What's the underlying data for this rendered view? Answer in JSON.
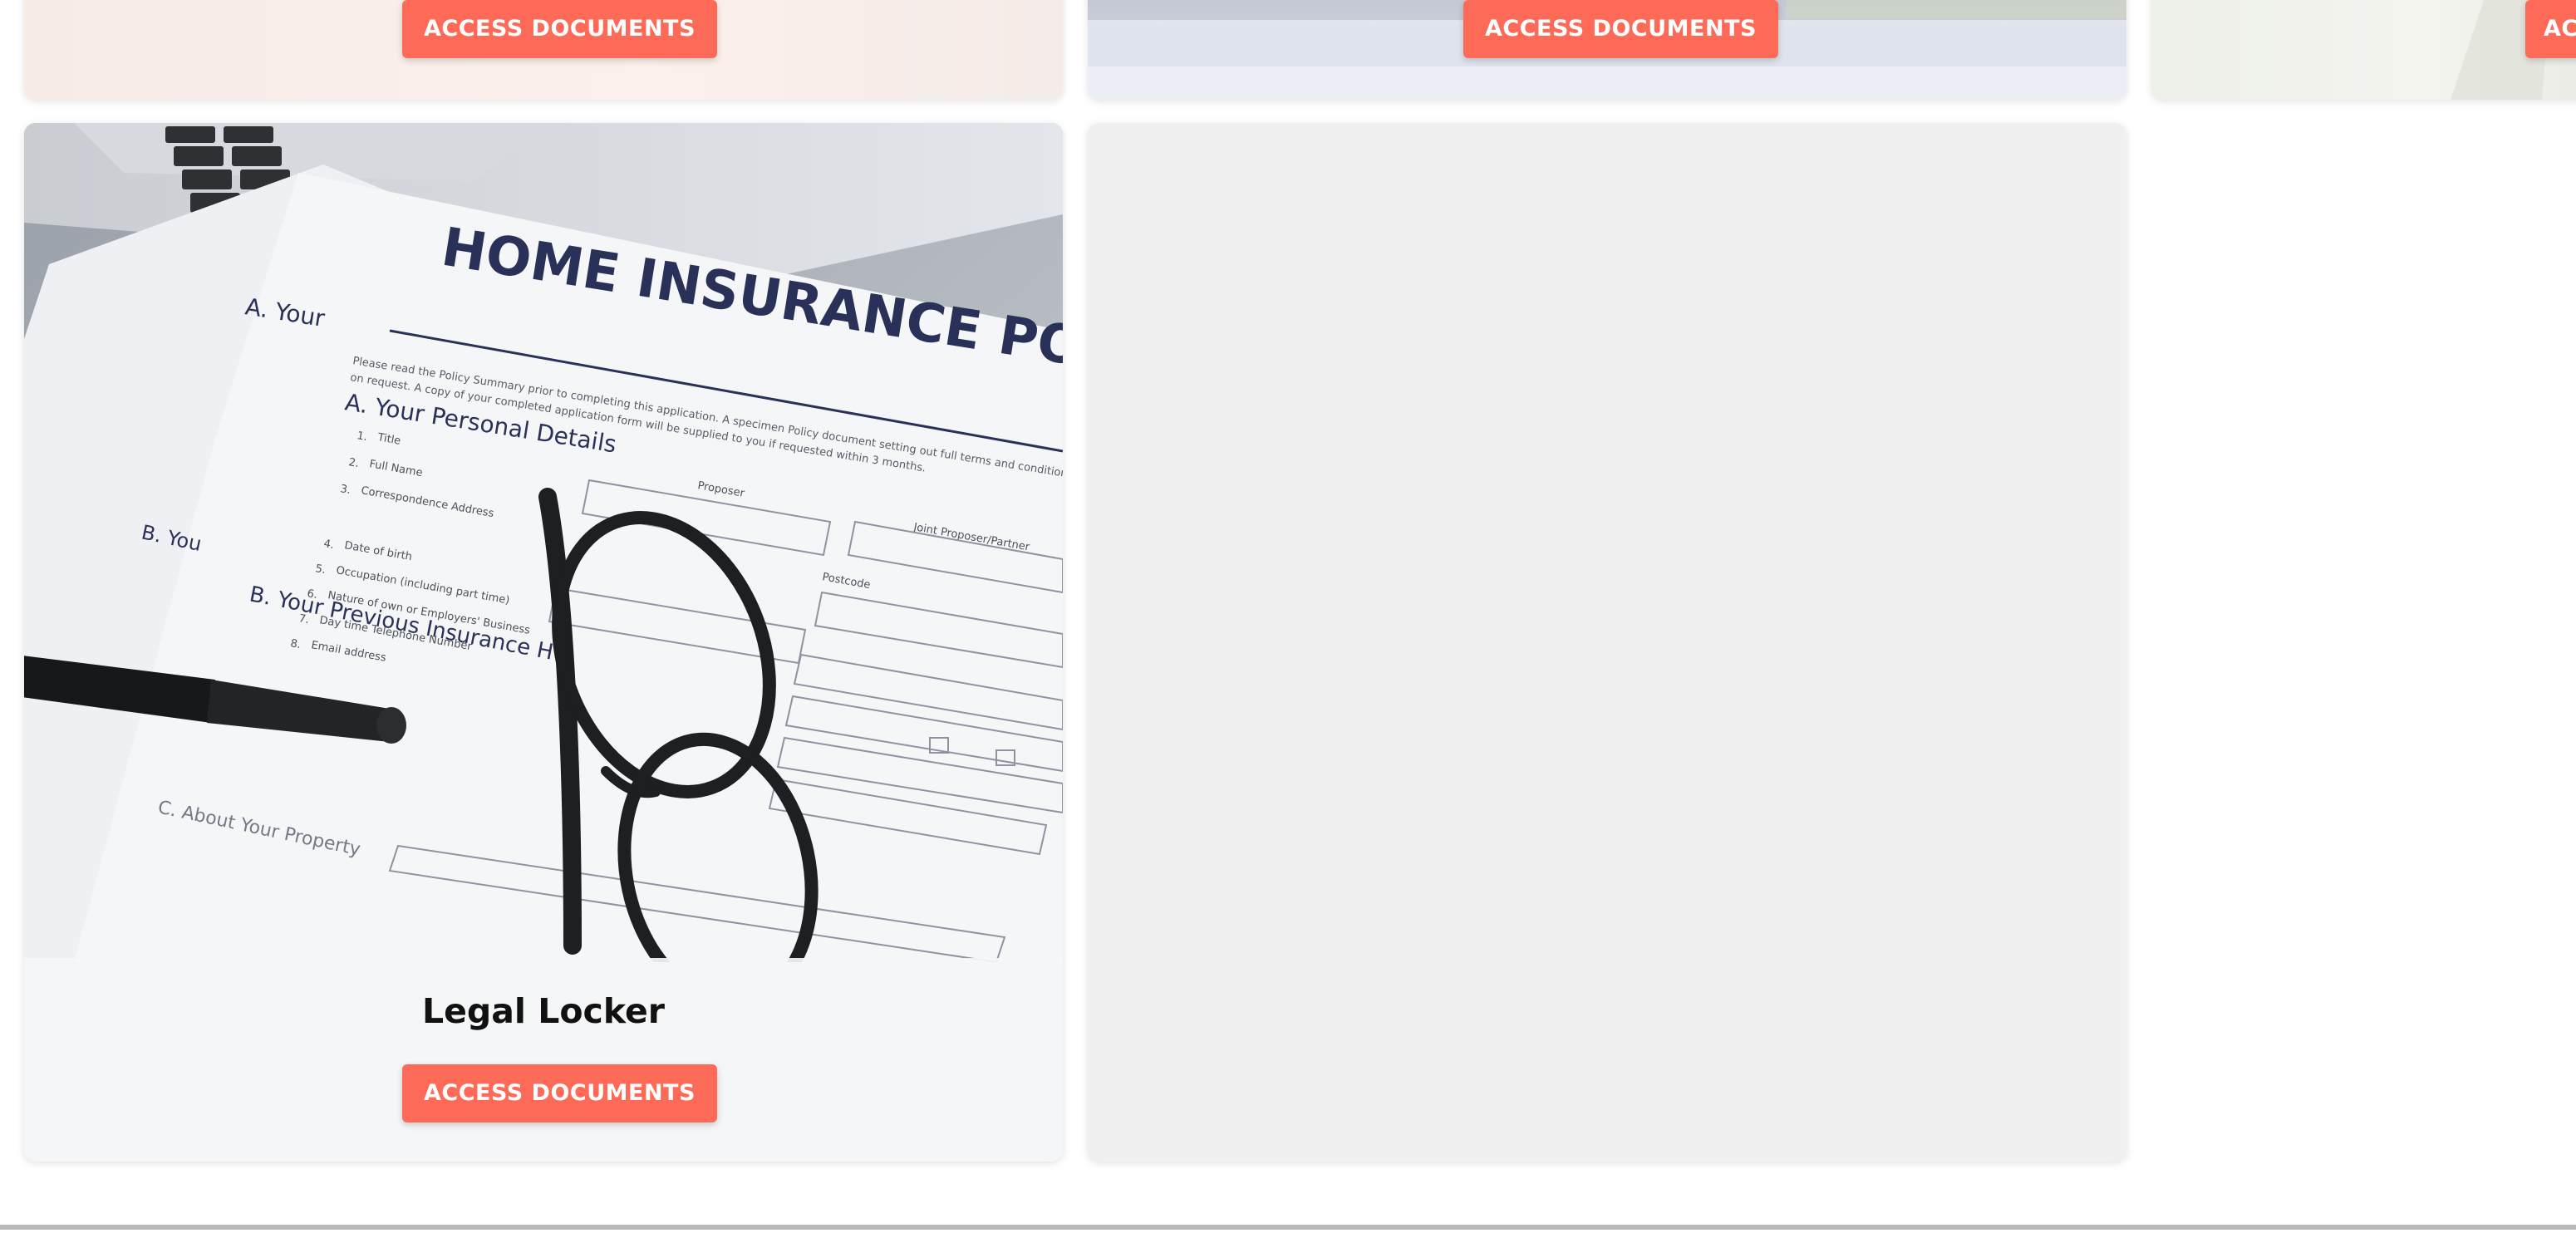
{
  "cards": [
    {
      "button_label": "ACCESS DOCUMENTS"
    },
    {
      "button_label": "ACCESS DOCUMENTS"
    },
    {
      "button_label": "ACC"
    },
    {
      "title": "Legal Locker",
      "button_label": "ACCESS DOCUMENTS"
    }
  ],
  "photo": {
    "doc_title": "HOME INSURANCE POLICY",
    "section_a": "A. Your Personal Details",
    "section_a_short": "A. Your",
    "section_b": "B. Your Previous Insurance H",
    "section_b_short": "B. You",
    "section_c": "C. About Your Property",
    "field_1": "Title",
    "field_2": "Full Name",
    "field_3": "Correspondence Address",
    "field_4": "Date of birth",
    "field_5": "Occupation (including part time)",
    "field_6": "Nature of own or Employers' Business",
    "field_7": "Day time Telephone Number",
    "field_8": "Email address",
    "label_proposer": "Proposer",
    "label_joint": "Joint Proposer/Partner",
    "label_postcode": "Postcode",
    "intro_text": "Please read the Policy Summary prior to completing this application. A specimen Policy document setting out full terms and conditions is also",
    "intro_text_2": "on request. A copy of your completed application form will be supplied to you if requested within 3 months."
  },
  "colors": {
    "accent": "#fe6a58",
    "empty_card": "#f0f0f0",
    "doc_title": "#2a3158"
  }
}
